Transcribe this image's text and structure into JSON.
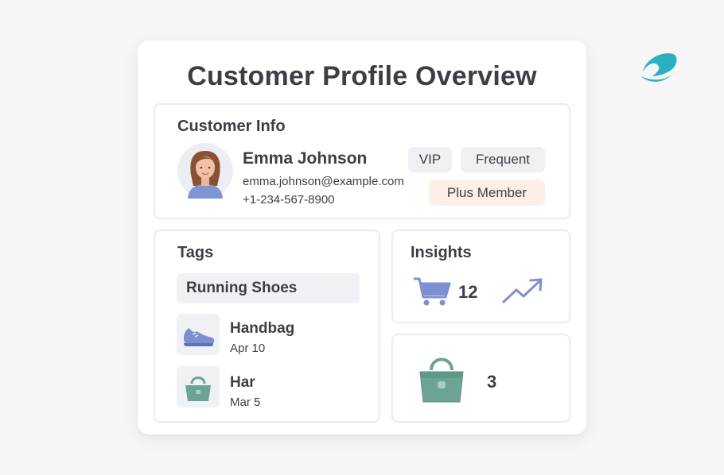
{
  "title": "Customer Profile Overview",
  "customer_info": {
    "heading": "Customer Info",
    "name": "Emma Johnson",
    "email": "emma.johnson@example.com",
    "phone": "+1-234-567-8900",
    "badges": [
      "VIP",
      "Frequent",
      "Plus Member"
    ]
  },
  "tags": {
    "heading": "Tags",
    "primary_tag": "Running Shoes",
    "items": [
      {
        "name": "Handbag",
        "date": "Apr 10",
        "icon": "shoe-icon"
      },
      {
        "name": "Har",
        "date": "Mar 5",
        "icon": "handbag-icon"
      }
    ]
  },
  "insights": {
    "heading": "Insights",
    "cart_count": "12",
    "bag_count": "3"
  },
  "colors": {
    "accent_blue": "#7d8fd1",
    "accent_green": "#6ca395",
    "plus_badge_bg": "#fdeee8",
    "logo": "#2ab1c0"
  }
}
